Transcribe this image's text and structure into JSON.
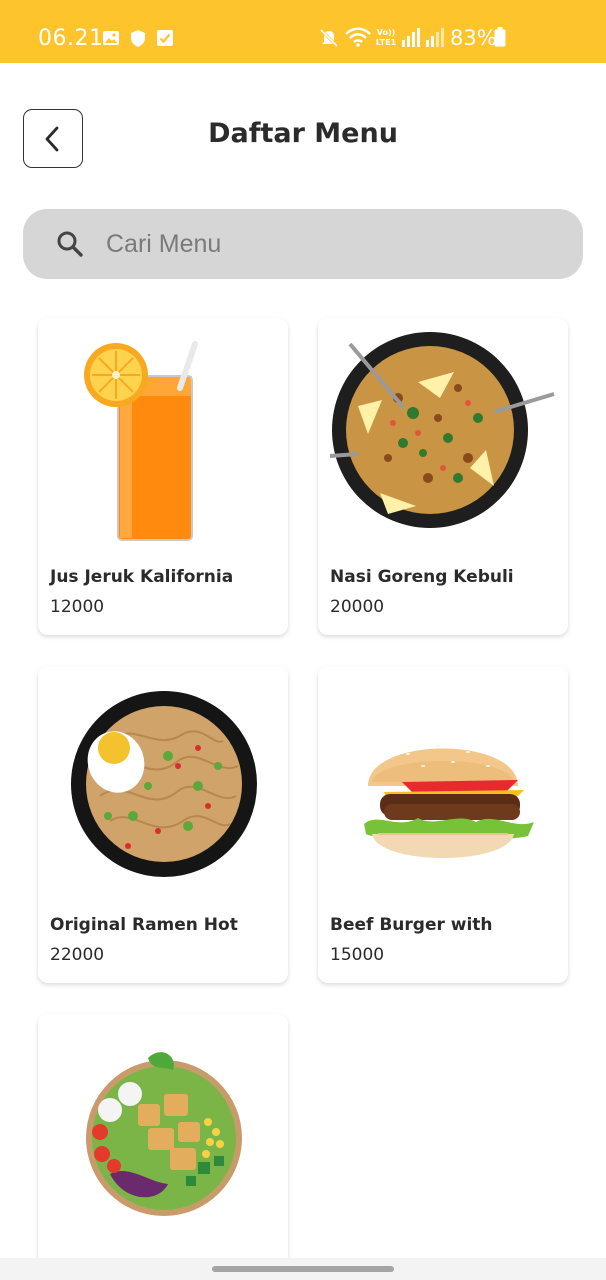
{
  "status_bar": {
    "time": "06.21",
    "battery_percent": "83%",
    "background_color": "#fdc42c",
    "icons": [
      "gallery-icon",
      "shield-icon",
      "checkbox-icon",
      "mute-icon",
      "wifi-icon",
      "volte-icon",
      "signal-icon",
      "signal-icon",
      "battery-icon"
    ]
  },
  "header": {
    "title": "Daftar Menu",
    "back_icon": "chevron-left-icon"
  },
  "search": {
    "placeholder": "Cari Menu",
    "value": "",
    "icon": "search-icon"
  },
  "menu_items": [
    {
      "name": "Jus Jeruk Kalifornia",
      "price": "12000",
      "image": "orange-juice-image"
    },
    {
      "name": "Nasi Goreng Kebuli",
      "price": "20000",
      "image": "fried-rice-image"
    },
    {
      "name": "Original Ramen Hot",
      "price": "22000",
      "image": "ramen-image"
    },
    {
      "name": "Beef Burger with",
      "price": "15000",
      "image": "burger-image"
    },
    {
      "name": "",
      "price": "",
      "image": "salad-bowl-image"
    }
  ]
}
